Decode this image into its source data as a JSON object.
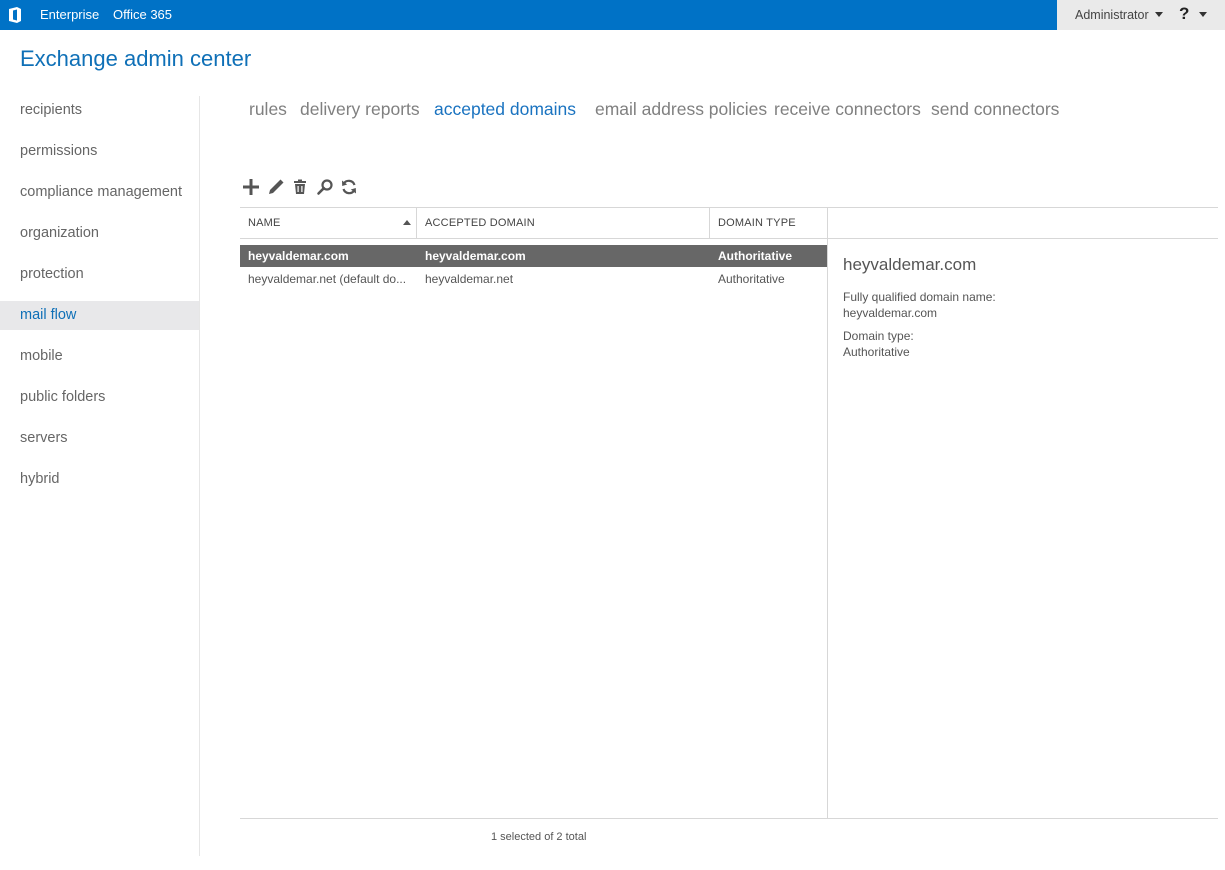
{
  "topbar": {
    "enterprise": "Enterprise",
    "office365": "Office 365",
    "user": "Administrator",
    "help": "?"
  },
  "app": {
    "title": "Exchange admin center"
  },
  "sidebar": {
    "items": [
      {
        "label": "recipients"
      },
      {
        "label": "permissions"
      },
      {
        "label": "compliance management"
      },
      {
        "label": "organization"
      },
      {
        "label": "protection"
      },
      {
        "label": "mail flow",
        "active": true
      },
      {
        "label": "mobile"
      },
      {
        "label": "public folders"
      },
      {
        "label": "servers"
      },
      {
        "label": "hybrid"
      }
    ]
  },
  "tabs": [
    {
      "label": "rules"
    },
    {
      "label": "delivery reports"
    },
    {
      "label": "accepted domains",
      "active": true
    },
    {
      "label": "email address policies"
    },
    {
      "label": "receive connectors"
    },
    {
      "label": "send connectors"
    }
  ],
  "toolbar": {
    "icons": [
      "add-icon",
      "edit-icon",
      "delete-icon",
      "search-icon",
      "refresh-icon"
    ]
  },
  "grid": {
    "columns": [
      "NAME",
      "ACCEPTED DOMAIN",
      "DOMAIN TYPE"
    ],
    "sort_column": "NAME",
    "sort_direction": "ascending",
    "rows": [
      {
        "name": "heyvaldemar.com",
        "domain": "heyvaldemar.com",
        "type": "Authoritative",
        "selected": true
      },
      {
        "name": "heyvaldemar.net (default do...",
        "domain": "heyvaldemar.net",
        "type": "Authoritative",
        "selected": false
      }
    ],
    "status": "1 selected of 2 total"
  },
  "detail": {
    "title": "heyvaldemar.com",
    "fqdn_label": "Fully qualified domain name:",
    "fqdn_value": "heyvaldemar.com",
    "type_label": "Domain type:",
    "type_value": "Authoritative"
  },
  "colors": {
    "brand_bar": "#0072c6",
    "accent_text": "#0f70b7",
    "selected_row": "#676767"
  }
}
